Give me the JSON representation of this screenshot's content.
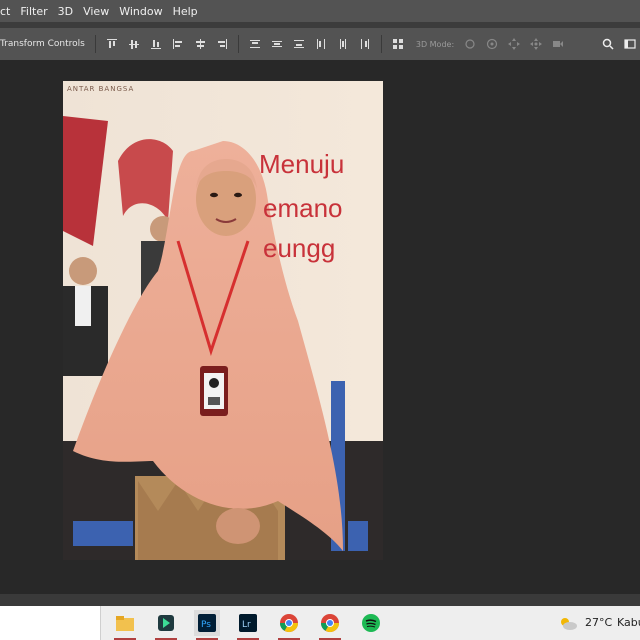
{
  "menu": [
    "ct",
    "Filter",
    "3D",
    "View",
    "Window",
    "Help"
  ],
  "options_bar": {
    "transform_label": "Transform Controls",
    "mode_label": "3D Mode:"
  },
  "canvas": {
    "banner_top_text": "ANTAR BANGSA",
    "banner_line1": "Menuju",
    "banner_line2": "emano",
    "banner_line3": "eungg"
  },
  "taskbar": {
    "weather_temp": "27°C",
    "location": "Kabu"
  },
  "colors": {
    "menubar": "#535353",
    "workspace": "#282828",
    "taskbar": "#eeeeee",
    "hijab": "#e8a88f"
  }
}
